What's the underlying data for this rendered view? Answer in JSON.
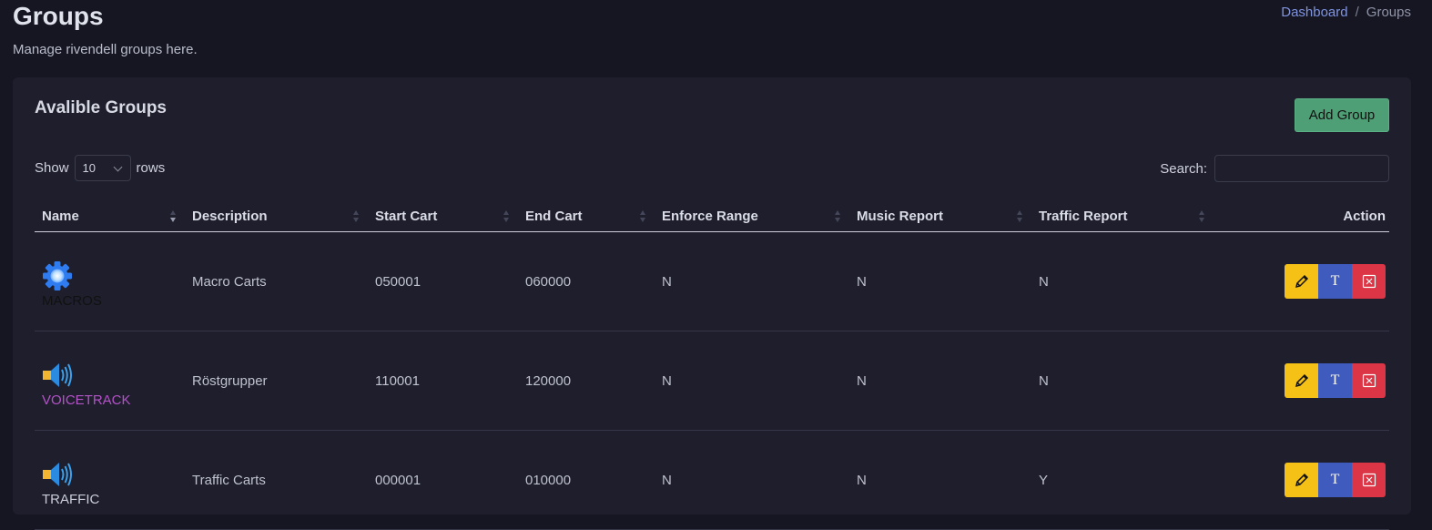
{
  "header": {
    "title": "Groups",
    "subtitle": "Manage rivendell groups here.",
    "breadcrumb": {
      "link": "Dashboard",
      "separator": "/",
      "current": "Groups"
    }
  },
  "card": {
    "title": "Avalible Groups",
    "add_button": "Add Group",
    "show_label": "Show",
    "rows_value": "10",
    "rows_label": "rows",
    "search_label": "Search:",
    "search_value": ""
  },
  "table": {
    "columns": [
      "Name",
      "Description",
      "Start Cart",
      "End Cart",
      "Enforce Range",
      "Music Report",
      "Traffic Report",
      "Action"
    ],
    "rows": [
      {
        "name": "MACROS",
        "name_color": "#111111",
        "icon": "gear-icon",
        "description": "Macro Carts",
        "start_cart": "050001",
        "end_cart": "060000",
        "enforce_range": "N",
        "music_report": "N",
        "traffic_report": "N"
      },
      {
        "name": "VOICETRACK",
        "name_color": "#b452c8",
        "icon": "speaker-icon",
        "description": "Röstgrupper",
        "start_cart": "110001",
        "end_cart": "120000",
        "enforce_range": "N",
        "music_report": "N",
        "traffic_report": "N"
      },
      {
        "name": "TRAFFIC",
        "name_color": "#c9ccd8",
        "icon": "speaker-icon",
        "description": "Traffic Carts",
        "start_cart": "000001",
        "end_cart": "010000",
        "enforce_range": "N",
        "music_report": "N",
        "traffic_report": "Y"
      }
    ],
    "action_text_label": "T"
  },
  "colors": {
    "background": "#161623",
    "card": "#1e1e2d",
    "add_button": "#4e9f75",
    "edit": "#f5c116",
    "text": "#3f5bbd",
    "delete": "#dc3545",
    "link": "#7f94e0"
  }
}
